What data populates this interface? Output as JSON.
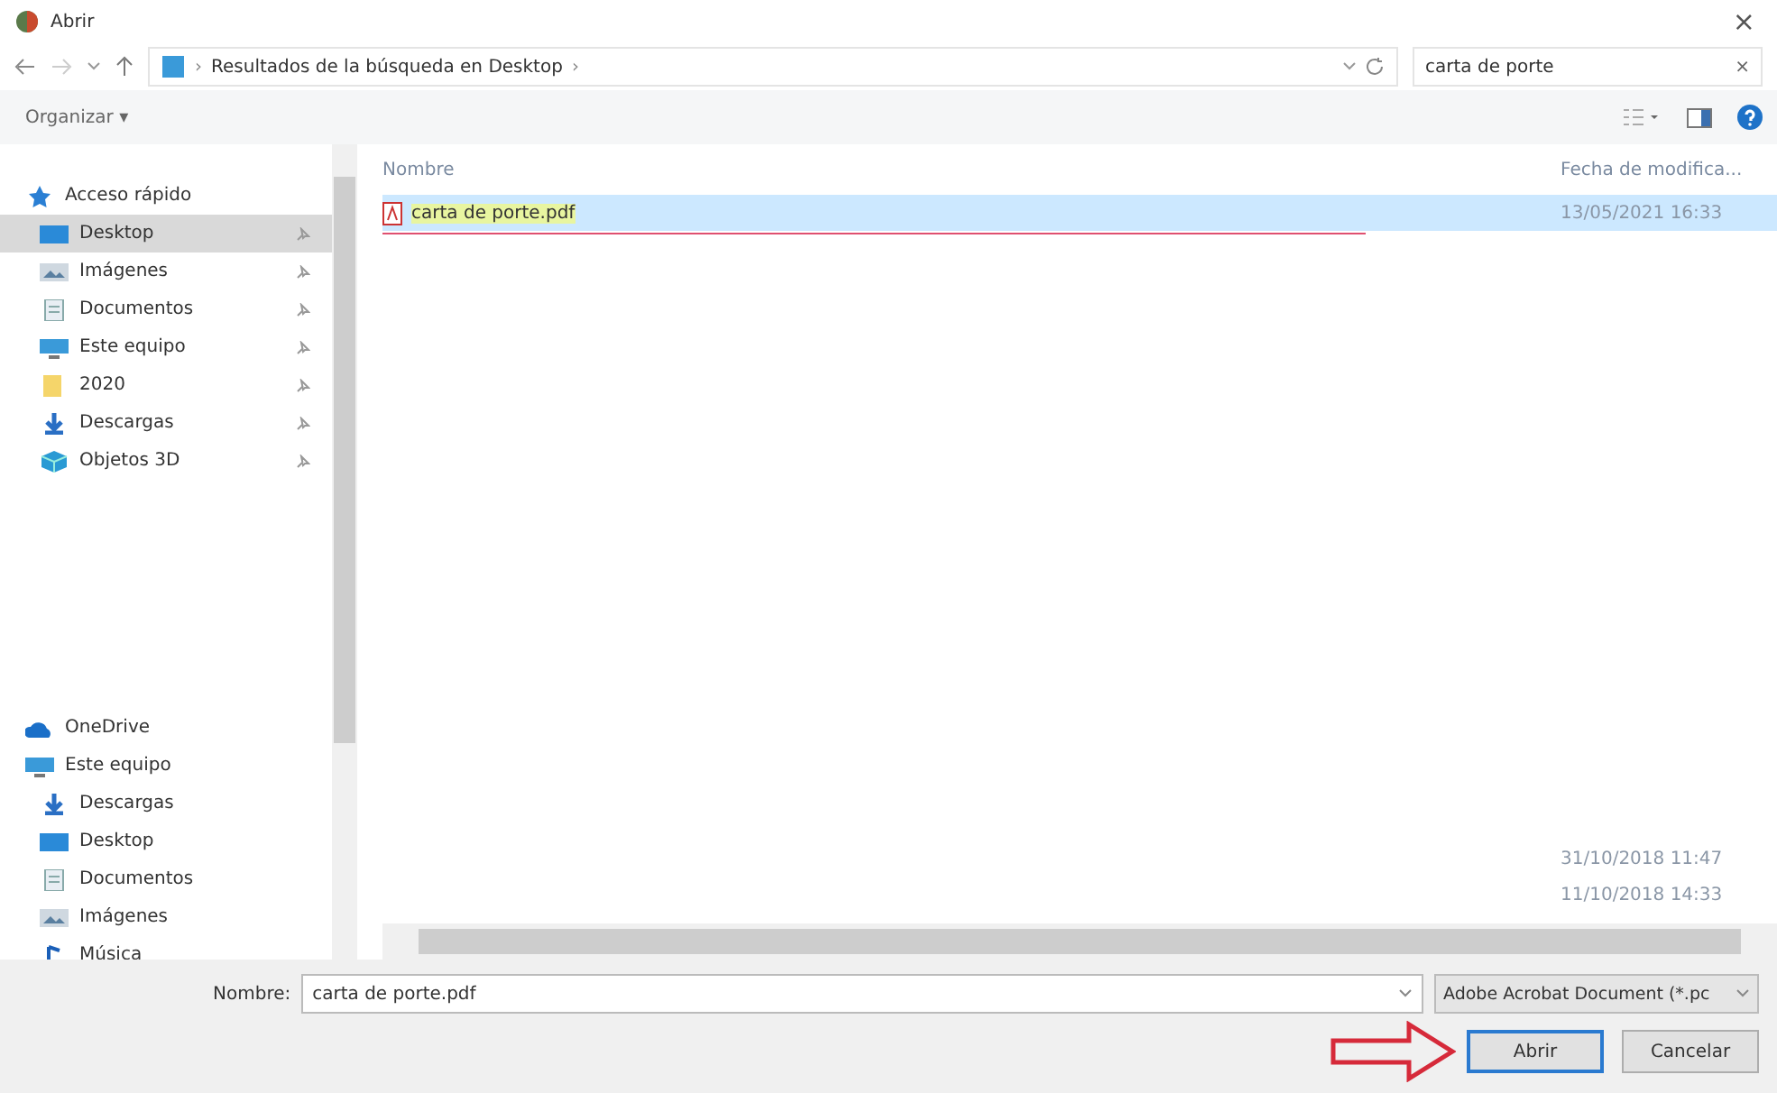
{
  "window": {
    "title": "Abrir",
    "close": "×"
  },
  "address": {
    "breadcrumb": [
      "›",
      "Resultados de la búsqueda en Desktop",
      "›"
    ],
    "search_value": "carta de porte",
    "search_clear": "×"
  },
  "toolbar": {
    "organize": "Organizar ▾"
  },
  "sidebar": {
    "sections": [
      {
        "label": "Acceso rápido",
        "kind": "star",
        "selected": false,
        "children": [
          {
            "label": "Desktop",
            "kind": "desktop",
            "selected": true,
            "pinned": true
          },
          {
            "label": "Imágenes",
            "kind": "pictures",
            "selected": false,
            "pinned": true
          },
          {
            "label": "Documentos",
            "kind": "document",
            "selected": false,
            "pinned": true
          },
          {
            "label": "Este equipo",
            "kind": "computer",
            "selected": false,
            "pinned": true
          },
          {
            "label": "2020",
            "kind": "folder",
            "selected": false,
            "pinned": true
          },
          {
            "label": "Descargas",
            "kind": "download",
            "selected": false,
            "pinned": true
          },
          {
            "label": "Objetos 3D",
            "kind": "cube",
            "selected": false,
            "pinned": true
          }
        ]
      },
      {
        "label": "OneDrive",
        "kind": "cloud",
        "selected": false
      },
      {
        "label": "Este equipo",
        "kind": "computer",
        "selected": false,
        "children": [
          {
            "label": "Descargas",
            "kind": "download",
            "selected": false,
            "pinned": false
          },
          {
            "label": "Desktop",
            "kind": "desktop",
            "selected": false,
            "pinned": false
          },
          {
            "label": "Documentos",
            "kind": "document",
            "selected": false,
            "pinned": false
          },
          {
            "label": "Imágenes",
            "kind": "pictures",
            "selected": false,
            "pinned": false
          },
          {
            "label": "Música",
            "kind": "music",
            "selected": false,
            "pinned": false
          }
        ]
      }
    ]
  },
  "files": {
    "columns": [
      "Nombre",
      "Fecha de modifica..."
    ],
    "rows": [
      {
        "name": "carta de porte.pdf",
        "date": "13/05/2021 16:33",
        "selected": true
      }
    ],
    "lower_rows": [
      {
        "date": "31/10/2018 11:47",
        "selected": false
      },
      {
        "date": "11/10/2018 14:33",
        "selected": false
      }
    ]
  },
  "footer": {
    "name_label": "Nombre:",
    "name_value": "carta de porte.pdf",
    "file_type": "Adobe Acrobat Document (*.pc",
    "open": "Abrir",
    "cancel": "Cancelar"
  }
}
